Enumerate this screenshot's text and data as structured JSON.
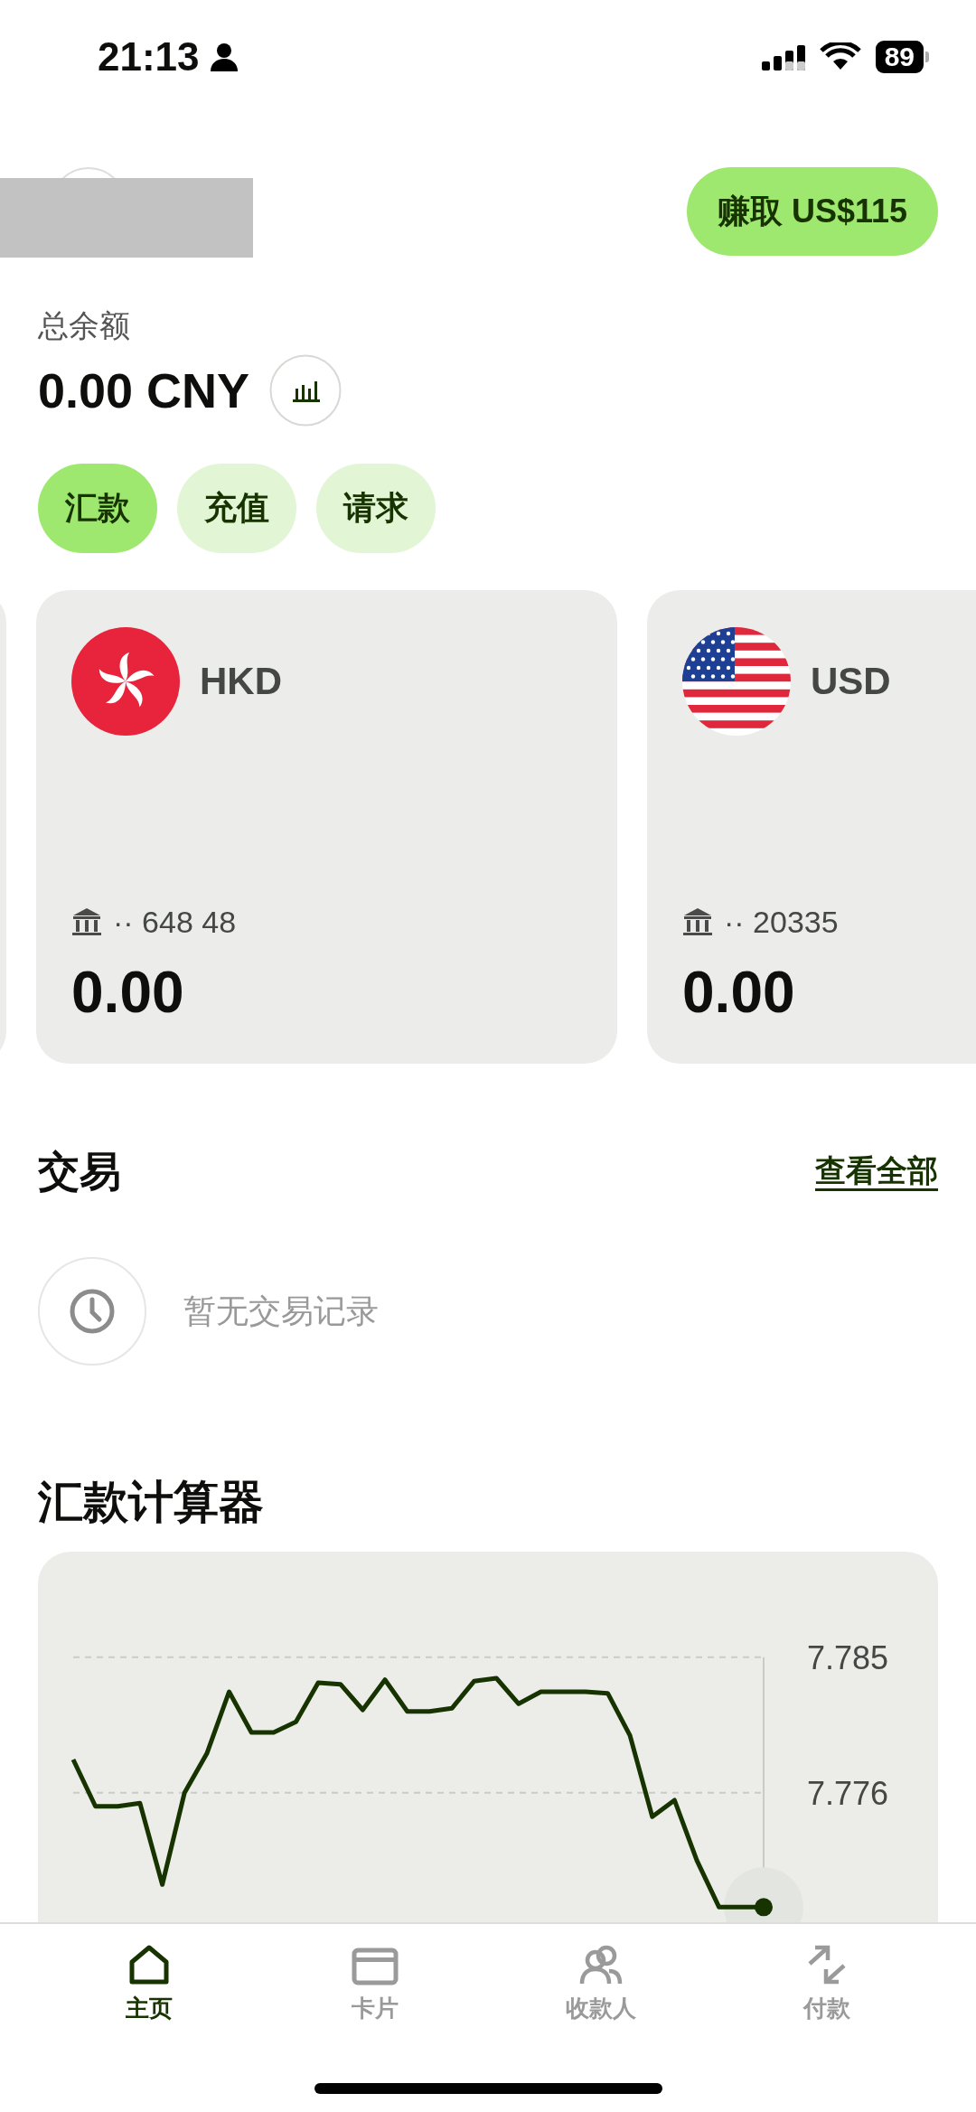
{
  "status_bar": {
    "time": "21:13",
    "battery": "89"
  },
  "header": {
    "earn_button": "赚取 US$115"
  },
  "balance": {
    "label": "总余额",
    "amount": "0.00 CNY"
  },
  "actions": [
    {
      "label": "汇款",
      "selected": true
    },
    {
      "label": "充值",
      "selected": false
    },
    {
      "label": "请求",
      "selected": false
    }
  ],
  "accounts": [
    {
      "kind": "hk",
      "currency": "HKD",
      "account": "·· 648 48",
      "amount": "0.00"
    },
    {
      "kind": "us",
      "currency": "USD",
      "account": "·· 20335",
      "amount": "0.00"
    }
  ],
  "transactions": {
    "title": "交易",
    "view_all": "查看全部",
    "empty_text": "暂无交易记录"
  },
  "calculator": {
    "title": "汇款计算器",
    "chart_data": {
      "type": "line",
      "ylim": [
        7.768,
        7.792
      ],
      "yticks": [
        7.776,
        7.785
      ],
      "series": [
        {
          "color": "#163300",
          "values": [
            7.7782,
            7.7751,
            7.7751,
            7.7753,
            7.7699,
            7.776,
            7.7786,
            7.7827,
            7.78,
            7.78,
            7.7807,
            7.7833,
            7.7832,
            7.7815,
            7.7835,
            7.7814,
            7.7814,
            7.7816,
            7.7834,
            7.7836,
            7.7819,
            7.7827,
            7.7827,
            7.7827,
            7.7826,
            7.7798,
            7.7744,
            7.7755,
            7.7715,
            7.7684,
            7.7684,
            7.7684
          ]
        }
      ]
    }
  },
  "bottom_nav": [
    {
      "kind": "home",
      "label": "主页",
      "selected": true
    },
    {
      "kind": "card",
      "label": "卡片",
      "selected": false
    },
    {
      "kind": "people",
      "label": "收款人",
      "selected": false
    },
    {
      "kind": "transfer",
      "label": "付款",
      "selected": false
    }
  ]
}
